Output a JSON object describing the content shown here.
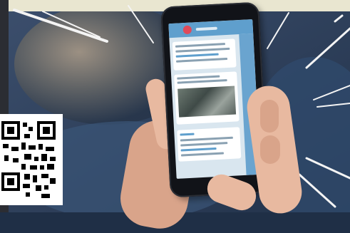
{
  "image": {
    "subject": "hands-holding-smartphone-with-messaging-app",
    "colors": {
      "background_blue": "#1f2f46",
      "top_strip": "#e9e6d0",
      "app_accent": "#5f9fcd",
      "avatar_red": "#e04a5a",
      "skin": "#e8b9a0"
    }
  }
}
